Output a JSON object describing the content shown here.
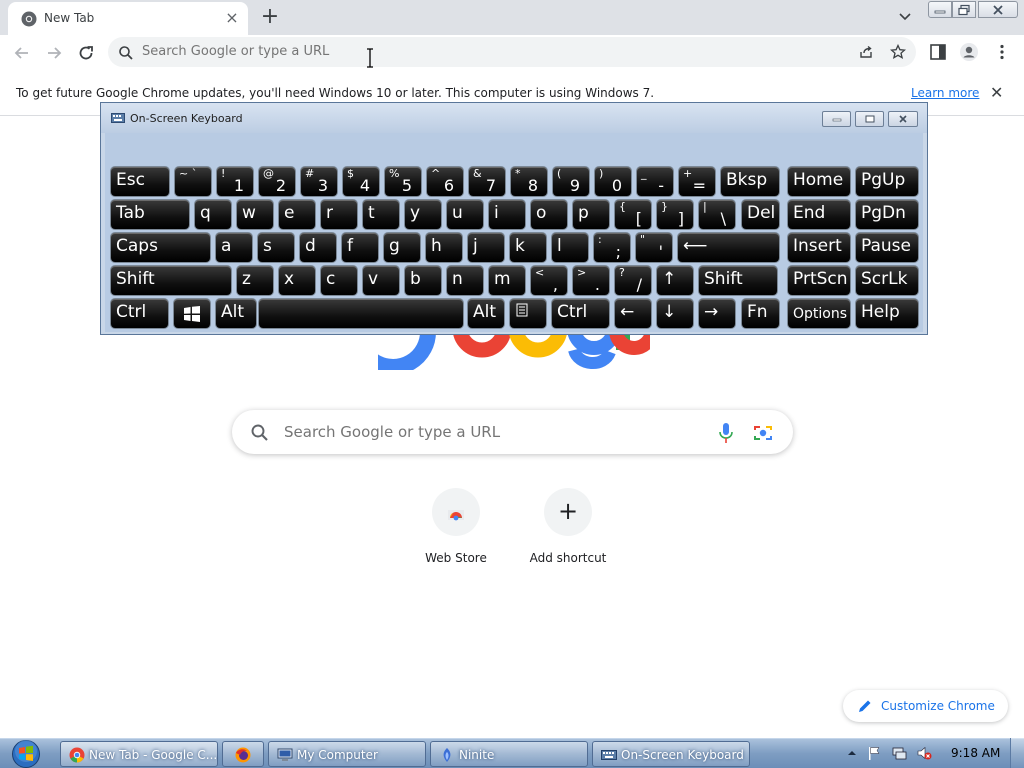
{
  "browser": {
    "tab": {
      "title": "New Tab",
      "favicon": "chrome-icon",
      "close": "×"
    },
    "new_tab": "+",
    "omnibox": {
      "placeholder": "Search Google or type a URL"
    }
  },
  "infobar": {
    "message": "To get future Google Chrome updates, you'll need Windows 10 or later. This computer is using Windows 7.",
    "link": "Learn more",
    "close": "✕"
  },
  "page": {
    "search": {
      "placeholder": "Search Google or type a URL"
    },
    "shortcuts": [
      {
        "label": "Web Store",
        "icon": "web-store-icon"
      },
      {
        "label": "Add shortcut",
        "icon": "plus-icon",
        "glyph": "+"
      }
    ],
    "customize": {
      "label": "Customize Chrome",
      "icon": "pencil-icon"
    },
    "logo_colors": {
      "blue": "#4285f4",
      "red": "#ea4335",
      "yellow": "#fbbc05",
      "green": "#34a853"
    }
  },
  "osk": {
    "title": "On-Screen Keyboard",
    "rows": [
      [
        {
          "label": "Esc"
        },
        {
          "sub": "~ `",
          "main": ""
        },
        {
          "sub": "!",
          "main": "1"
        },
        {
          "sub": "@",
          "main": "2"
        },
        {
          "sub": "#",
          "main": "3"
        },
        {
          "sub": "$",
          "main": "4"
        },
        {
          "sub": "%",
          "main": "5"
        },
        {
          "sub": "^",
          "main": "6"
        },
        {
          "sub": "&",
          "main": "7"
        },
        {
          "sub": "*",
          "main": "8"
        },
        {
          "sub": "(",
          "main": "9"
        },
        {
          "sub": ")",
          "main": "0"
        },
        {
          "sub": "_",
          "main": "-"
        },
        {
          "sub": "+",
          "main": "="
        },
        {
          "label": "Bksp"
        },
        {
          "label": "Home"
        },
        {
          "label": "PgUp"
        }
      ],
      [
        {
          "label": "Tab"
        },
        {
          "label": "q"
        },
        {
          "label": "w"
        },
        {
          "label": "e"
        },
        {
          "label": "r"
        },
        {
          "label": "t"
        },
        {
          "label": "y"
        },
        {
          "label": "u"
        },
        {
          "label": "i"
        },
        {
          "label": "o"
        },
        {
          "label": "p"
        },
        {
          "sub": "{",
          "main": "["
        },
        {
          "sub": "}",
          "main": "]"
        },
        {
          "sub": "|",
          "main": "\\"
        },
        {
          "label": "Del"
        },
        {
          "label": "End"
        },
        {
          "label": "PgDn"
        }
      ],
      [
        {
          "label": "Caps"
        },
        {
          "label": "a"
        },
        {
          "label": "s"
        },
        {
          "label": "d"
        },
        {
          "label": "f"
        },
        {
          "label": "g"
        },
        {
          "label": "h"
        },
        {
          "label": "j"
        },
        {
          "label": "k"
        },
        {
          "label": "l"
        },
        {
          "sub": ":",
          "main": ";"
        },
        {
          "sub": "\"",
          "main": "'"
        },
        {
          "label": "⟵"
        },
        {
          "label": "Insert"
        },
        {
          "label": "Pause"
        }
      ],
      [
        {
          "label": "Shift"
        },
        {
          "label": "z"
        },
        {
          "label": "x"
        },
        {
          "label": "c"
        },
        {
          "label": "v"
        },
        {
          "label": "b"
        },
        {
          "label": "n"
        },
        {
          "label": "m"
        },
        {
          "sub": "<",
          "main": ","
        },
        {
          "sub": ">",
          "main": "."
        },
        {
          "sub": "?",
          "main": "/"
        },
        {
          "label": "↑"
        },
        {
          "label": "Shift"
        },
        {
          "label": "PrtScn"
        },
        {
          "label": "ScrLk"
        }
      ],
      [
        {
          "label": "Ctrl"
        },
        {
          "label": "",
          "icon": "windows-logo-icon"
        },
        {
          "label": "Alt"
        },
        {
          "label": ""
        },
        {
          "label": "Alt"
        },
        {
          "label": "",
          "icon": "menu-key-icon"
        },
        {
          "label": "Ctrl"
        },
        {
          "label": "←"
        },
        {
          "label": "↓"
        },
        {
          "label": "→"
        },
        {
          "label": "Fn"
        },
        {
          "label": "Options"
        },
        {
          "label": "Help"
        }
      ]
    ]
  },
  "taskbar": {
    "items": [
      {
        "label": "New Tab - Google C...",
        "icon": "chrome-icon"
      },
      {
        "label": "",
        "icon": "firefox-icon"
      },
      {
        "label": "My Computer",
        "icon": "computer-icon"
      },
      {
        "label": "Ninite",
        "icon": "ninite-icon"
      },
      {
        "label": "On-Screen Keyboard",
        "icon": "keyboard-icon"
      }
    ],
    "clock": "9:18 AM"
  }
}
